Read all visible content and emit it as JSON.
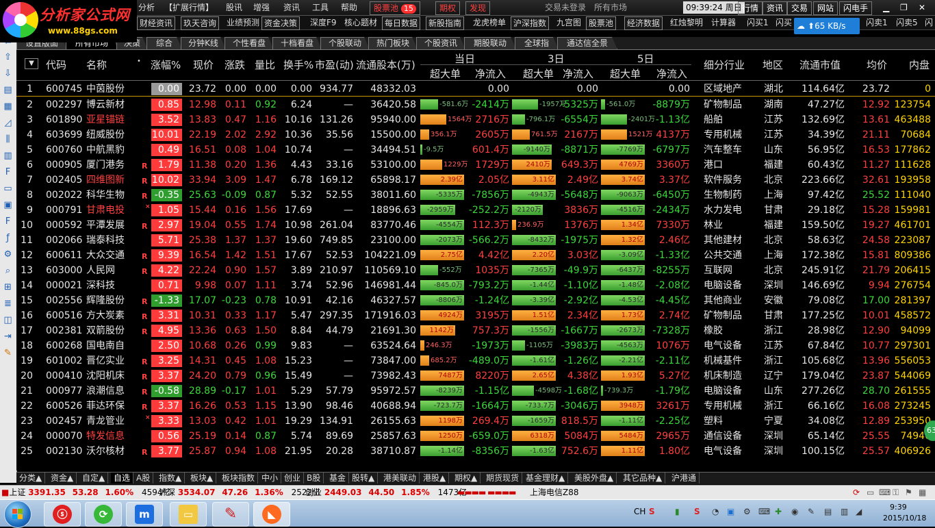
{
  "app": {
    "brand": "分析家公式网",
    "brand_url": "www.88gs.com",
    "menus": [
      "分析",
      "【扩展行情】",
      "股讯",
      "增强",
      "资讯",
      "工具",
      "帮助"
    ],
    "stock_pool_label": "股票池",
    "stock_pool_count": "15",
    "options_label": "期权",
    "launch_label": "发现",
    "status_left": "交易未登录",
    "status_market": "所有市场",
    "clock": "09:39:24",
    "weekday": "周日",
    "right_menus": [
      "行情",
      "资讯",
      "交易",
      "网站",
      "闪电手"
    ]
  },
  "toolbar": {
    "items": [
      "财经资讯",
      "玖天咨询",
      "业绩预测",
      "资金决策",
      "深度F9",
      "核心题材",
      "每日数据",
      "新股指南",
      "龙虎榜单",
      "沪深指数",
      "九宫图",
      "股票池",
      "经济数据",
      "红烛黎明",
      "计算器",
      "闪买1",
      "闪买"
    ],
    "right_items": [
      "闪卖1",
      "闪卖5",
      "闪"
    ],
    "net_speed": "65 KB/s"
  },
  "tabs": [
    "设置版面",
    "所有市场",
    "决策",
    "综合",
    "分钟K线",
    "个性看盘",
    "十档看盘",
    "个股联动",
    "热门板块",
    "个股资讯",
    "期股联动",
    "全球指",
    "通达信全景"
  ],
  "active_tab": "所有市场",
  "columns": {
    "code": "代码",
    "name": "名称",
    "pct": "涨幅%",
    "price": "现价",
    "chg": "涨跌",
    "vr": "量比",
    "turnover": "换手%",
    "pe": "市盈(动)",
    "shares": "流通股本(万)",
    "period_1": "当日",
    "period_3": "3日",
    "period_5": "5日",
    "big": "超大单",
    "net": "净流入",
    "industry": "细分行业",
    "region": "地区",
    "mcap": "流通市值",
    "avg": "均价",
    "inner": "内盘"
  },
  "rows": [
    {
      "n": "1",
      "code": "600745",
      "name": "中茵股份",
      "mk": "",
      "pct": "0.00",
      "price": "23.72",
      "chg": "0.00",
      "vr": "0.00",
      "to": "0.00",
      "pe": "934.77",
      "sh": "48332.03",
      "b1": "",
      "b1v": 0,
      "n1": "0.00",
      "b3": "",
      "b3v": 0,
      "n3": "0.00",
      "b5": "",
      "b5v": 0,
      "n5": "0.00",
      "ind": "区域地产",
      "reg": "湖北",
      "mcap": "114.64亿",
      "avg": "23.72",
      "inner": "0"
    },
    {
      "n": "2",
      "code": "002297",
      "name": "博云新材",
      "mk": "",
      "pct": "0.85",
      "price": "12.98",
      "chg": "0.11",
      "vr": "0.92",
      "to": "6.24",
      "pe": "—",
      "sh": "36420.58",
      "b1": "-581.6万",
      "b1v": -0.4,
      "n1": "-2414万",
      "b3": "-1957万",
      "b3v": -0.6,
      "n3": "-5325万",
      "b5": "-561.0万",
      "b5v": -0.1,
      "n5": "-8879万",
      "ind": "矿物制品",
      "reg": "湖南",
      "mcap": "47.27亿",
      "avg": "12.92",
      "inner": "123754"
    },
    {
      "n": "3",
      "code": "601890",
      "name": "亚星锚链",
      "mk": "",
      "pct": "3.52",
      "price": "13.83",
      "chg": "0.47",
      "vr": "1.16",
      "to": "10.16",
      "pe": "131.26",
      "sh": "95940.00",
      "b1": "1564万",
      "b1v": 0.6,
      "n1": "2716万",
      "b3": "-796.1万",
      "b3v": -0.3,
      "n3": "-6554万",
      "b5": "-2401万",
      "b5v": -0.6,
      "n5": "-1.13亿",
      "ind": "船舶",
      "reg": "江苏",
      "mcap": "132.69亿",
      "avg": "13.61",
      "inner": "463488"
    },
    {
      "n": "4",
      "code": "603699",
      "name": "纽威股份",
      "mk": "",
      "pct": "10.01",
      "price": "22.19",
      "chg": "2.02",
      "vr": "2.92",
      "to": "10.36",
      "pe": "35.56",
      "sh": "15500.00",
      "b1": "356.1万",
      "b1v": 0.2,
      "n1": "2605万",
      "b3": "761.5万",
      "b3v": 0.4,
      "n3": "2167万",
      "b5": "1521万",
      "b5v": 0.6,
      "n5": "4137万",
      "ind": "专用机械",
      "reg": "江苏",
      "mcap": "34.39亿",
      "avg": "21.11",
      "inner": "70684"
    },
    {
      "n": "5",
      "code": "600760",
      "name": "中航黑豹",
      "mk": "",
      "pct": "0.49",
      "price": "16.51",
      "chg": "0.08",
      "vr": "1.04",
      "to": "10.74",
      "pe": "—",
      "sh": "34494.51",
      "b1": "-9.5万",
      "b1v": -0.02,
      "n1": "601.4万",
      "b3": "-9140万",
      "b3v": -0.9,
      "n3": "-8871万",
      "b5": "-7769万",
      "b5v": -1.0,
      "n5": "-6797万",
      "ind": "汽车整车",
      "reg": "山东",
      "mcap": "56.95亿",
      "avg": "16.53",
      "inner": "177862"
    },
    {
      "n": "6",
      "code": "000905",
      "name": "厦门港务",
      "mk": "R",
      "pct": "1.79",
      "price": "11.38",
      "chg": "0.20",
      "vr": "1.36",
      "to": "4.43",
      "pe": "33.16",
      "sh": "53100.00",
      "b1": "1229万",
      "b1v": 0.5,
      "n1": "1729万",
      "b3": "2410万",
      "b3v": 0.9,
      "n3": "649.3万",
      "b5": "4769万",
      "b5v": 1.0,
      "n5": "3360万",
      "ind": "港口",
      "reg": "福建",
      "mcap": "60.43亿",
      "avg": "11.27",
      "inner": "111628"
    },
    {
      "n": "7",
      "code": "002405",
      "name": "四维图新",
      "mk": "R",
      "pct": "10.02",
      "price": "33.94",
      "chg": "3.09",
      "vr": "1.47",
      "to": "6.78",
      "pe": "169.12",
      "sh": "65898.17",
      "b1": "2.39亿",
      "b1v": 1.0,
      "n1": "2.05亿",
      "b3": "3.11亿",
      "b3v": 1.0,
      "n3": "2.49亿",
      "b5": "3.74亿",
      "b5v": 1.0,
      "n5": "3.37亿",
      "ind": "软件服务",
      "reg": "北京",
      "mcap": "223.66亿",
      "avg": "32.61",
      "inner": "193958"
    },
    {
      "n": "8",
      "code": "002022",
      "name": "科华生物",
      "mk": "R",
      "pct": "-0.35",
      "price": "25.63",
      "chg": "-0.09",
      "vr": "0.87",
      "to": "5.32",
      "pe": "52.55",
      "sh": "38011.60",
      "b1": "-5335万",
      "b1v": -1.0,
      "n1": "-7856万",
      "b3": "-4943万",
      "b3v": -1.0,
      "n3": "-5648万",
      "b5": "-9063万",
      "b5v": -1.0,
      "n5": "-6450万",
      "ind": "生物制药",
      "reg": "上海",
      "mcap": "97.42亿",
      "avg": "25.52",
      "inner": "111040"
    },
    {
      "n": "9",
      "code": "000791",
      "name": "甘肃电投",
      "mk": "×",
      "pct": "1.05",
      "price": "15.44",
      "chg": "0.16",
      "vr": "1.56",
      "to": "17.69",
      "pe": "—",
      "sh": "18896.63",
      "b1": "-2959万",
      "b1v": -0.8,
      "n1": "-252.2万",
      "b3": "-2120万",
      "b3v": -0.7,
      "n3": "3836万",
      "b5": "-4516万",
      "b5v": -1.0,
      "n5": "-2434万",
      "ind": "水力发电",
      "reg": "甘肃",
      "mcap": "29.18亿",
      "avg": "15.28",
      "inner": "159981"
    },
    {
      "n": "10",
      "code": "000592",
      "name": "平潭发展",
      "mk": "R",
      "pct": "2.97",
      "price": "19.04",
      "chg": "0.55",
      "vr": "1.74",
      "to": "10.98",
      "pe": "261.04",
      "sh": "83770.46",
      "b1": "-4554万",
      "b1v": -1.0,
      "n1": "112.3万",
      "b3": "236.9万",
      "b3v": 0.1,
      "n3": "1376万",
      "b5": "1.34亿",
      "b5v": 1.0,
      "n5": "7330万",
      "ind": "林业",
      "reg": "福建",
      "mcap": "159.50亿",
      "avg": "19.27",
      "inner": "461701"
    },
    {
      "n": "11",
      "code": "002066",
      "name": "瑞泰科技",
      "mk": "",
      "pct": "5.71",
      "price": "25.38",
      "chg": "1.37",
      "vr": "1.37",
      "to": "19.60",
      "pe": "749.85",
      "sh": "23100.00",
      "b1": "-2073万",
      "b1v": -1.0,
      "n1": "-566.2万",
      "b3": "-8432万",
      "b3v": -1.0,
      "n3": "-1975万",
      "b5": "1.32亿",
      "b5v": 1.0,
      "n5": "2.46亿",
      "ind": "其他建材",
      "reg": "北京",
      "mcap": "58.63亿",
      "avg": "24.58",
      "inner": "223087"
    },
    {
      "n": "12",
      "code": "600611",
      "name": "大众交通",
      "mk": "R",
      "pct": "9.39",
      "price": "16.54",
      "chg": "1.42",
      "vr": "1.51",
      "to": "17.67",
      "pe": "52.53",
      "sh": "104221.09",
      "b1": "2.75亿",
      "b1v": 1.0,
      "n1": "4.42亿",
      "b3": "2.20亿",
      "b3v": 1.0,
      "n3": "3.03亿",
      "b5": "-3.09亿",
      "b5v": -1.0,
      "n5": "-1.33亿",
      "ind": "公共交通",
      "reg": "上海",
      "mcap": "172.38亿",
      "avg": "15.81",
      "inner": "809386"
    },
    {
      "n": "13",
      "code": "603000",
      "name": "人民网",
      "mk": "R",
      "pct": "4.22",
      "price": "22.24",
      "chg": "0.90",
      "vr": "1.57",
      "to": "3.89",
      "pe": "210.97",
      "sh": "110569.10",
      "b1": "-552万",
      "b1v": -0.4,
      "n1": "1035万",
      "b3": "-7365万",
      "b3v": -1.0,
      "n3": "-49.9万",
      "b5": "-6437万",
      "b5v": -1.0,
      "n5": "-8255万",
      "ind": "互联网",
      "reg": "北京",
      "mcap": "245.91亿",
      "avg": "21.79",
      "inner": "206415"
    },
    {
      "n": "14",
      "code": "000021",
      "name": "深科技",
      "mk": "",
      "pct": "0.71",
      "price": "9.98",
      "chg": "0.07",
      "vr": "1.11",
      "to": "3.74",
      "pe": "52.96",
      "sh": "146981.44",
      "b1": "-845.0万",
      "b1v": -1.0,
      "n1": "-793.2万",
      "b3": "-1.44亿",
      "b3v": -1.0,
      "n3": "-1.10亿",
      "b5": "-1.48亿",
      "b5v": -1.0,
      "n5": "-2.08亿",
      "ind": "电脑设备",
      "reg": "深圳",
      "mcap": "146.69亿",
      "avg": "9.94",
      "inner": "276754"
    },
    {
      "n": "15",
      "code": "002556",
      "name": "辉隆股份",
      "mk": "R",
      "pct": "-1.33",
      "price": "17.07",
      "chg": "-0.23",
      "vr": "0.78",
      "to": "10.91",
      "pe": "42.16",
      "sh": "46327.57",
      "b1": "-8806万",
      "b1v": -1.0,
      "n1": "-1.24亿",
      "b3": "-3.39亿",
      "b3v": -1.0,
      "n3": "-2.92亿",
      "b5": "-4.53亿",
      "b5v": -1.0,
      "n5": "-4.45亿",
      "ind": "其他商业",
      "reg": "安徽",
      "mcap": "79.08亿",
      "avg": "17.00",
      "inner": "281397"
    },
    {
      "n": "16",
      "code": "600516",
      "name": "方大炭素",
      "mk": "R",
      "pct": "3.31",
      "price": "10.31",
      "chg": "0.33",
      "vr": "1.17",
      "to": "5.47",
      "pe": "297.35",
      "sh": "171916.03",
      "b1": "4924万",
      "b1v": 1.0,
      "n1": "3195万",
      "b3": "1.51亿",
      "b3v": 1.0,
      "n3": "2.34亿",
      "b5": "1.73亿",
      "b5v": 1.0,
      "n5": "2.74亿",
      "ind": "矿物制品",
      "reg": "甘肃",
      "mcap": "177.25亿",
      "avg": "10.01",
      "inner": "458572"
    },
    {
      "n": "17",
      "code": "002381",
      "name": "双箭股份",
      "mk": "R",
      "pct": "4.95",
      "price": "13.36",
      "chg": "0.63",
      "vr": "1.50",
      "to": "8.84",
      "pe": "44.79",
      "sh": "21691.30",
      "b1": "1142万",
      "b1v": 0.8,
      "n1": "757.3万",
      "b3": "-1556万",
      "b3v": -1.0,
      "n3": "-1667万",
      "b5": "-2673万",
      "b5v": -1.0,
      "n5": "-7328万",
      "ind": "橡胶",
      "reg": "浙江",
      "mcap": "28.98亿",
      "avg": "12.90",
      "inner": "94099"
    },
    {
      "n": "18",
      "code": "600268",
      "name": "国电南自",
      "mk": "",
      "pct": "2.50",
      "price": "10.68",
      "chg": "0.26",
      "vr": "0.99",
      "to": "9.83",
      "pe": "—",
      "sh": "63524.64",
      "b1": "246.3万",
      "b1v": 0.1,
      "n1": "-1973万",
      "b3": "-1105万",
      "b3v": -0.3,
      "n3": "-3983万",
      "b5": "-4563万",
      "b5v": -1.0,
      "n5": "1076万",
      "ind": "电气设备",
      "reg": "江苏",
      "mcap": "67.84亿",
      "avg": "10.77",
      "inner": "297301"
    },
    {
      "n": "19",
      "code": "601002",
      "name": "晋亿实业",
      "mk": "R",
      "pct": "3.25",
      "price": "14.31",
      "chg": "0.45",
      "vr": "1.08",
      "to": "15.23",
      "pe": "—",
      "sh": "73847.00",
      "b1": "685.2万",
      "b1v": 0.2,
      "n1": "-489.0万",
      "b3": "-1.61亿",
      "b3v": -1.0,
      "n3": "-1.26亿",
      "b5": "-2.21亿",
      "b5v": -1.0,
      "n5": "-2.11亿",
      "ind": "机械基件",
      "reg": "浙江",
      "mcap": "105.68亿",
      "avg": "13.96",
      "inner": "556053"
    },
    {
      "n": "20",
      "code": "000410",
      "name": "沈阳机床",
      "mk": "R",
      "pct": "3.37",
      "price": "24.20",
      "chg": "0.79",
      "vr": "0.96",
      "to": "15.49",
      "pe": "—",
      "sh": "73982.43",
      "b1": "7487万",
      "b1v": 1.0,
      "n1": "8220万",
      "b3": "2.65亿",
      "b3v": 1.0,
      "n3": "4.38亿",
      "b5": "1.93亿",
      "b5v": 1.0,
      "n5": "5.27亿",
      "ind": "机床制造",
      "reg": "辽宁",
      "mcap": "179.04亿",
      "avg": "23.87",
      "inner": "544069"
    },
    {
      "n": "21",
      "code": "000977",
      "name": "浪潮信息",
      "mk": "R",
      "pct": "-0.58",
      "price": "28.89",
      "chg": "-0.17",
      "vr": "1.01",
      "to": "5.29",
      "pe": "57.79",
      "sh": "95972.57",
      "b1": "-8239万",
      "b1v": -1.0,
      "n1": "-1.15亿",
      "b3": "-4598万",
      "b3v": -0.5,
      "n3": "-1.68亿",
      "b5": "-739.3万",
      "b5v": -0.05,
      "n5": "-1.79亿",
      "ind": "电脑设备",
      "reg": "山东",
      "mcap": "277.26亿",
      "avg": "28.70",
      "inner": "261555"
    },
    {
      "n": "22",
      "code": "600526",
      "name": "菲达环保",
      "mk": "R",
      "pct": "3.37",
      "price": "16.26",
      "chg": "0.53",
      "vr": "1.15",
      "to": "13.90",
      "pe": "98.46",
      "sh": "40688.94",
      "b1": "-723.7万",
      "b1v": -1.0,
      "n1": "-1664万",
      "b3": "-733.7万",
      "b3v": -1.0,
      "n3": "-3046万",
      "b5": "3948万",
      "b5v": 1.0,
      "n5": "3261万",
      "ind": "专用机械",
      "reg": "浙江",
      "mcap": "66.16亿",
      "avg": "16.08",
      "inner": "273245"
    },
    {
      "n": "23",
      "code": "002457",
      "name": "青龙管业",
      "mk": "×",
      "pct": "3.33",
      "price": "13.03",
      "chg": "0.42",
      "vr": "1.01",
      "to": "19.29",
      "pe": "134.91",
      "sh": "26155.63",
      "b1": "1198万",
      "b1v": 1.0,
      "n1": "269.4万",
      "b3": "-1659万",
      "b3v": -1.0,
      "n3": "818.5万",
      "b5": "-1.11亿",
      "b5v": -1.0,
      "n5": "-2.25亿",
      "ind": "塑料",
      "reg": "宁夏",
      "mcap": "34.08亿",
      "avg": "12.89",
      "inner": "253950"
    },
    {
      "n": "24",
      "code": "000070",
      "name": "特发信息",
      "mk": "",
      "pct": "0.56",
      "price": "25.19",
      "chg": "0.14",
      "vr": "0.87",
      "to": "5.74",
      "pe": "89.69",
      "sh": "25857.63",
      "b1": "1250万",
      "b1v": 1.0,
      "n1": "-659.0万",
      "b3": "6318万",
      "b3v": 1.0,
      "n3": "5084万",
      "b5": "5484万",
      "b5v": 1.0,
      "n5": "2965万",
      "ind": "通信设备",
      "reg": "深圳",
      "mcap": "65.14亿",
      "avg": "25.55",
      "inner": "74940"
    },
    {
      "n": "25",
      "code": "002130",
      "name": "沃尔核材",
      "mk": "R",
      "pct": "3.77",
      "price": "25.87",
      "chg": "0.94",
      "vr": "1.08",
      "to": "21.95",
      "pe": "20.28",
      "sh": "38710.87",
      "b1": "-1.14亿",
      "b1v": -1.0,
      "n1": "-8356万",
      "b3": "-1.63亿",
      "b3v": -1.0,
      "n3": "752.6万",
      "b5": "1.11亿",
      "b5v": 1.0,
      "n5": "1.80亿",
      "ind": "电气设备",
      "reg": "深圳",
      "mcap": "100.15亿",
      "avg": "25.57",
      "inner": "406926"
    }
  ],
  "bottom_tabs": [
    "分类▲",
    "资金▲",
    "自定▲",
    "自选",
    "A股",
    "指数▲",
    "板块▲",
    "板块指数",
    "中小",
    "创业",
    "B股",
    "基金",
    "股转▲",
    "港美联动",
    "港股▲",
    "期权▲",
    "期货现货",
    "基金理财▲",
    "美股外盘▲",
    "其它品种▲",
    "沪港通"
  ],
  "active_bottom_tab": "自选",
  "status": {
    "sh_label": "上证",
    "sh_val": "3391.35",
    "sh_chg": "53.28",
    "sh_pct": "1.60%",
    "sh_amt": "4594亿",
    "sz_label": "沪深",
    "sz_val": "3534.07",
    "sz_chg": "47.26",
    "sz_pct": "1.36%",
    "sz_amt": "2522亿",
    "cy_label": "创业",
    "cy_val": "2449.03",
    "cy_chg": "44.50",
    "cy_pct": "1.85%",
    "cy_amt": "1473亿",
    "server": "上海电信Z88"
  },
  "taskbar": {
    "lang": "CH",
    "time": "9:39",
    "date": "2015/10/18"
  },
  "colors": {
    "up": "#ff4040",
    "down": "#3cd83c",
    "accent": "#ffd500"
  }
}
